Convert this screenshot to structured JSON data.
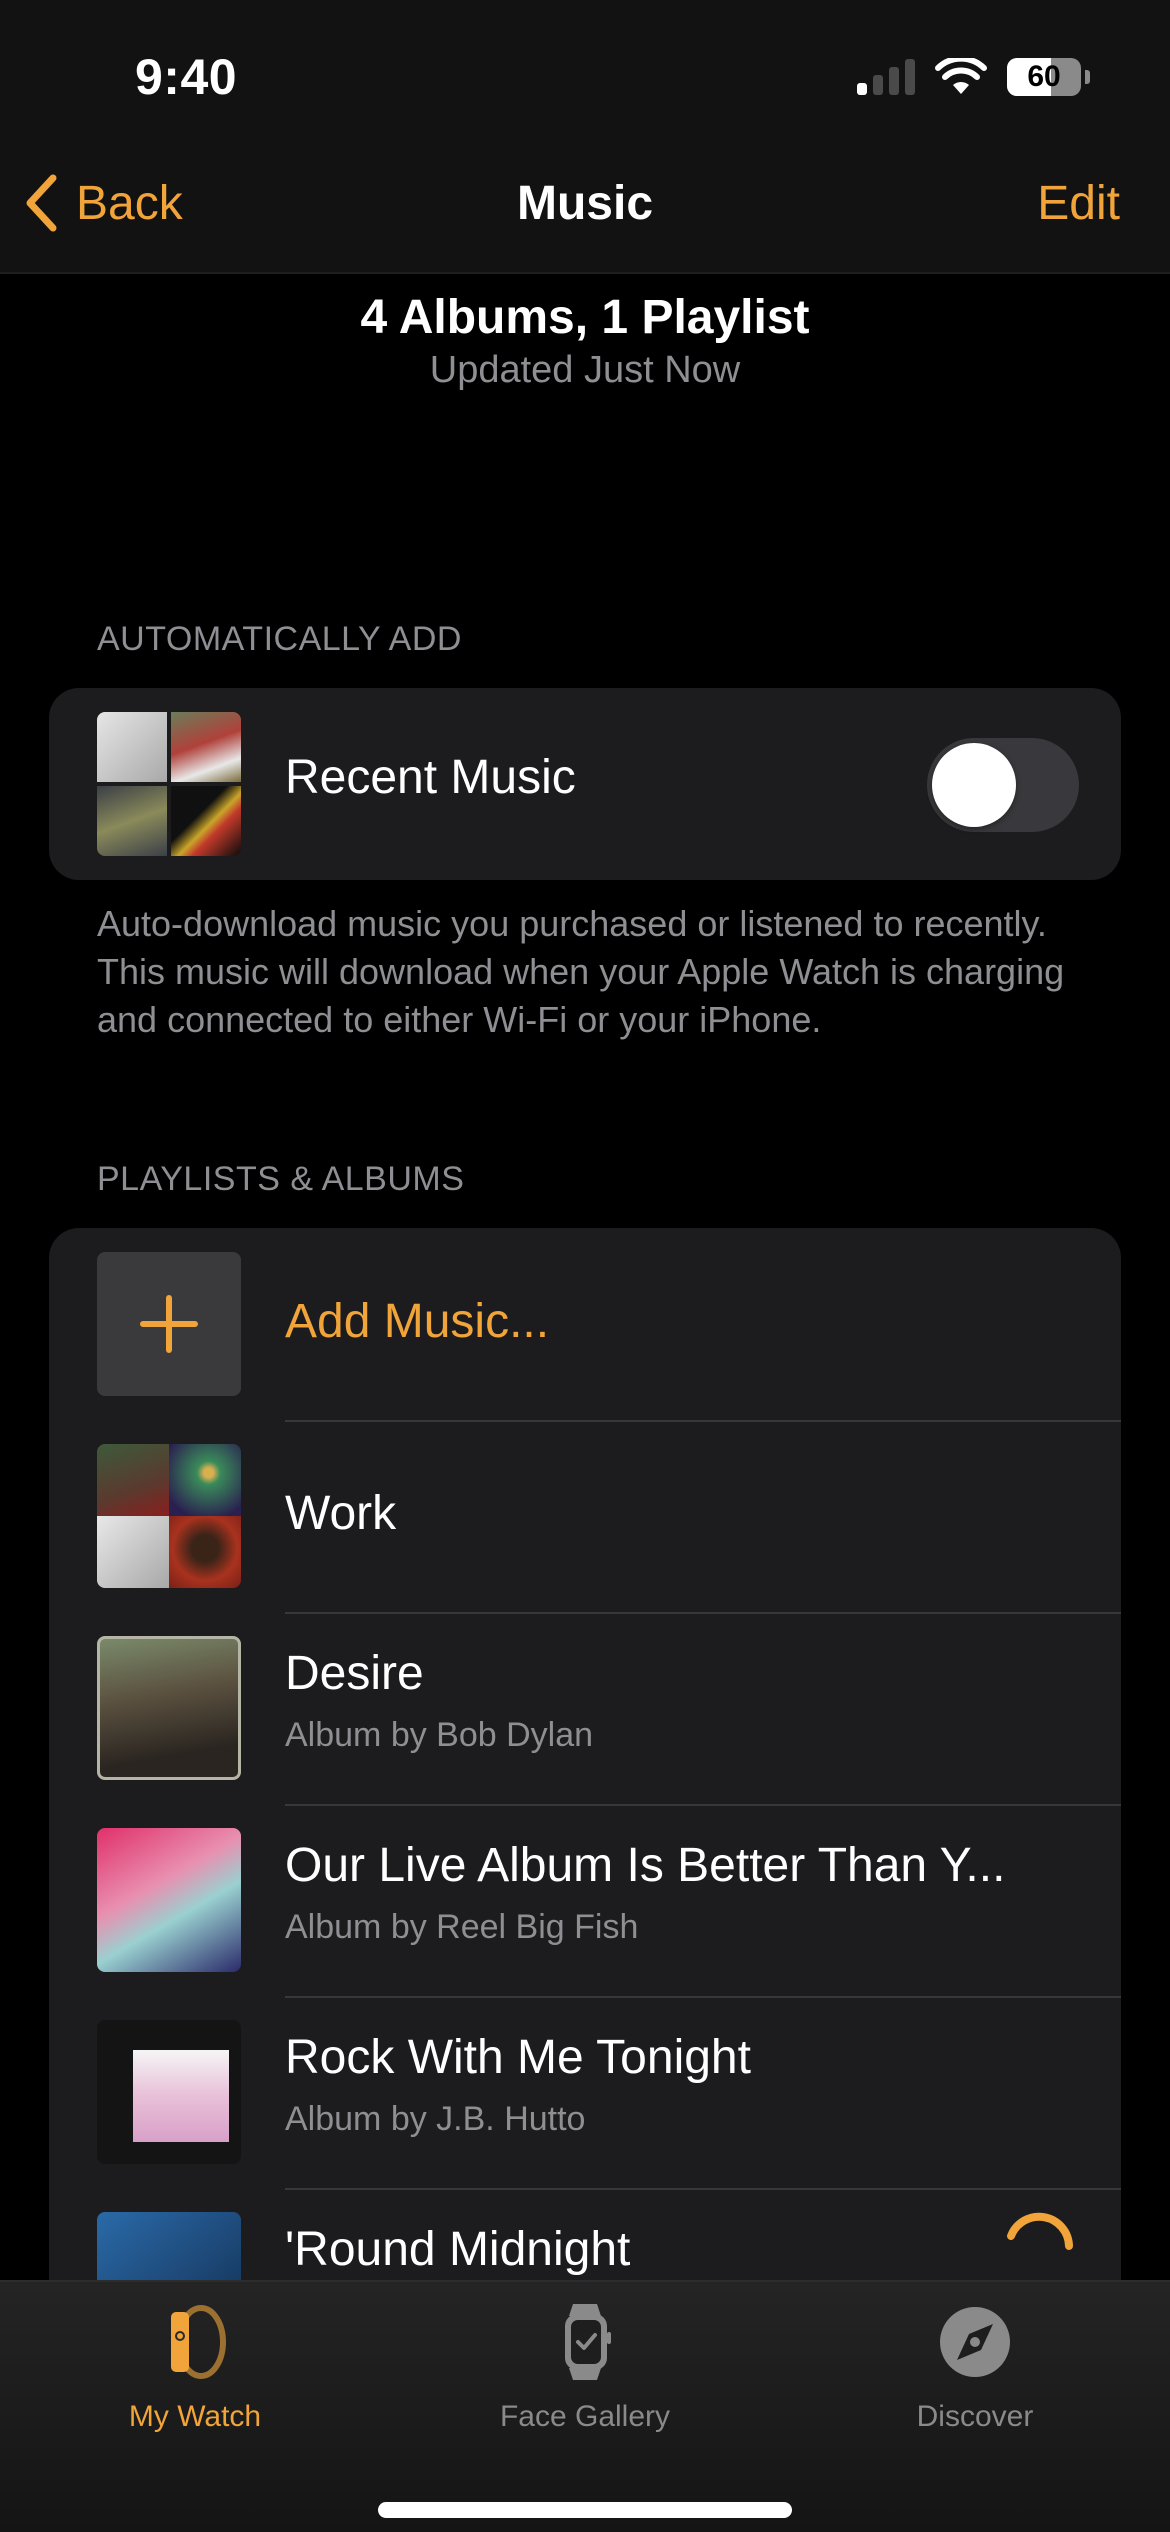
{
  "status_bar": {
    "time": "9:40",
    "signal_bars_active": 1,
    "signal_bars_total": 4,
    "wifi": "full",
    "battery_percent": 60,
    "battery_label": "60"
  },
  "nav": {
    "back_label": "Back",
    "title": "Music",
    "edit_label": "Edit"
  },
  "summary": {
    "title": "4 Albums, 1 Playlist",
    "subtitle": "Updated Just Now"
  },
  "automatically_add": {
    "header": "AUTOMATICALLY ADD",
    "item": {
      "title": "Recent Music",
      "toggle_on": false,
      "art": [
        "#c8c8c8",
        "#a43a2a",
        "#4a5563",
        "#1a1a1a"
      ]
    },
    "footnote": "Auto-download music you purchased or listened to recently. This music will download when your Apple Watch is charging and connected to either Wi-Fi or your iPhone."
  },
  "playlists_albums": {
    "header": "PLAYLISTS & ALBUMS",
    "add_label": "Add Music...",
    "items": [
      {
        "title": "Work",
        "subtitle": "",
        "type": "playlist",
        "art": [
          "#5a3a2e",
          "#3a8a5a",
          "#cfcfcf",
          "#8a2a20"
        ]
      },
      {
        "title": "Desire",
        "subtitle": "Album by Bob Dylan",
        "type": "album",
        "art": [
          "#5b5140"
        ]
      },
      {
        "title": "Our Live Album Is Better Than Y...",
        "subtitle": "Album by Reel Big Fish",
        "type": "album",
        "art": [
          "#d8457a"
        ]
      },
      {
        "title": "Rock With Me Tonight",
        "subtitle": "Album by J.B. Hutto",
        "type": "album",
        "art": [
          "#1a1a1a"
        ]
      },
      {
        "title": "'Round Midnight",
        "subtitle": "",
        "type": "album",
        "art": [
          "#1e4a7a"
        ],
        "downloading": true
      }
    ]
  },
  "tabbar": {
    "tabs": [
      {
        "label": "My Watch",
        "icon": "watch-side-icon",
        "active": true
      },
      {
        "label": "Face Gallery",
        "icon": "watch-face-icon",
        "active": false
      },
      {
        "label": "Discover",
        "icon": "compass-icon",
        "active": false
      }
    ]
  },
  "colors": {
    "accent": "#f0a43a",
    "background": "#000000",
    "card": "#1c1c1e",
    "secondary_text": "#8e8e93",
    "inactive_tab": "#8a8a8a"
  }
}
